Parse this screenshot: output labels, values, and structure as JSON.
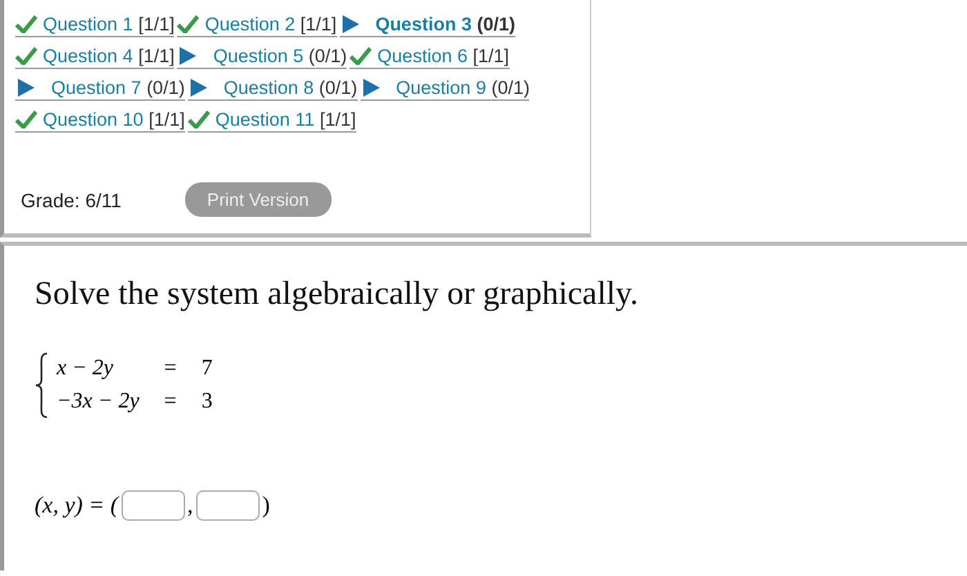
{
  "questions": [
    {
      "kind": "correct",
      "label": "Question 1",
      "score": "[1/1]",
      "selected": false
    },
    {
      "kind": "correct",
      "label": "Question 2",
      "score": "[1/1]",
      "selected": false
    },
    {
      "kind": "pending",
      "label": "Question 3",
      "score": "(0/1)",
      "selected": true
    },
    {
      "kind": "correct",
      "label": "Question 4",
      "score": "[1/1]",
      "selected": false
    },
    {
      "kind": "pending",
      "label": "Question 5",
      "score": "(0/1)",
      "selected": false
    },
    {
      "kind": "correct",
      "label": "Question 6",
      "score": "[1/1]",
      "selected": false
    },
    {
      "kind": "pending",
      "label": "Question 7",
      "score": "(0/1)",
      "selected": false
    },
    {
      "kind": "pending",
      "label": "Question 8",
      "score": "(0/1)",
      "selected": false
    },
    {
      "kind": "pending",
      "label": "Question 9",
      "score": "(0/1)",
      "selected": false
    },
    {
      "kind": "correct",
      "label": "Question 10",
      "score": "[1/1]",
      "selected": false
    },
    {
      "kind": "correct",
      "label": "Question 11",
      "score": "[1/1]",
      "selected": false
    }
  ],
  "grade": "Grade: 6/11",
  "print_button": "Print Version",
  "prompt": "Solve the system algebraically or graphically.",
  "equations": [
    {
      "lhs": "x − 2y",
      "sign": "=",
      "rhs": "7"
    },
    {
      "lhs": "−3x − 2y",
      "sign": "=",
      "rhs": "3"
    }
  ],
  "answer": {
    "prefix": "(x, y) = (",
    "separator": ",",
    "suffix": ")"
  }
}
